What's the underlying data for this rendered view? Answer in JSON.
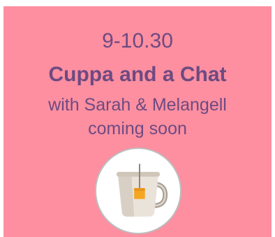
{
  "event": {
    "time": "9-10.30",
    "title": "Cuppa and a Chat",
    "hosts": "with Sarah & Melangell",
    "status": "coming soon"
  },
  "icon": "tea-mug-icon",
  "colors": {
    "background": "#fd8fa0",
    "text": "#6e4a82",
    "icon_circle": "#ffffff",
    "tea_tag": "#f5a623"
  }
}
